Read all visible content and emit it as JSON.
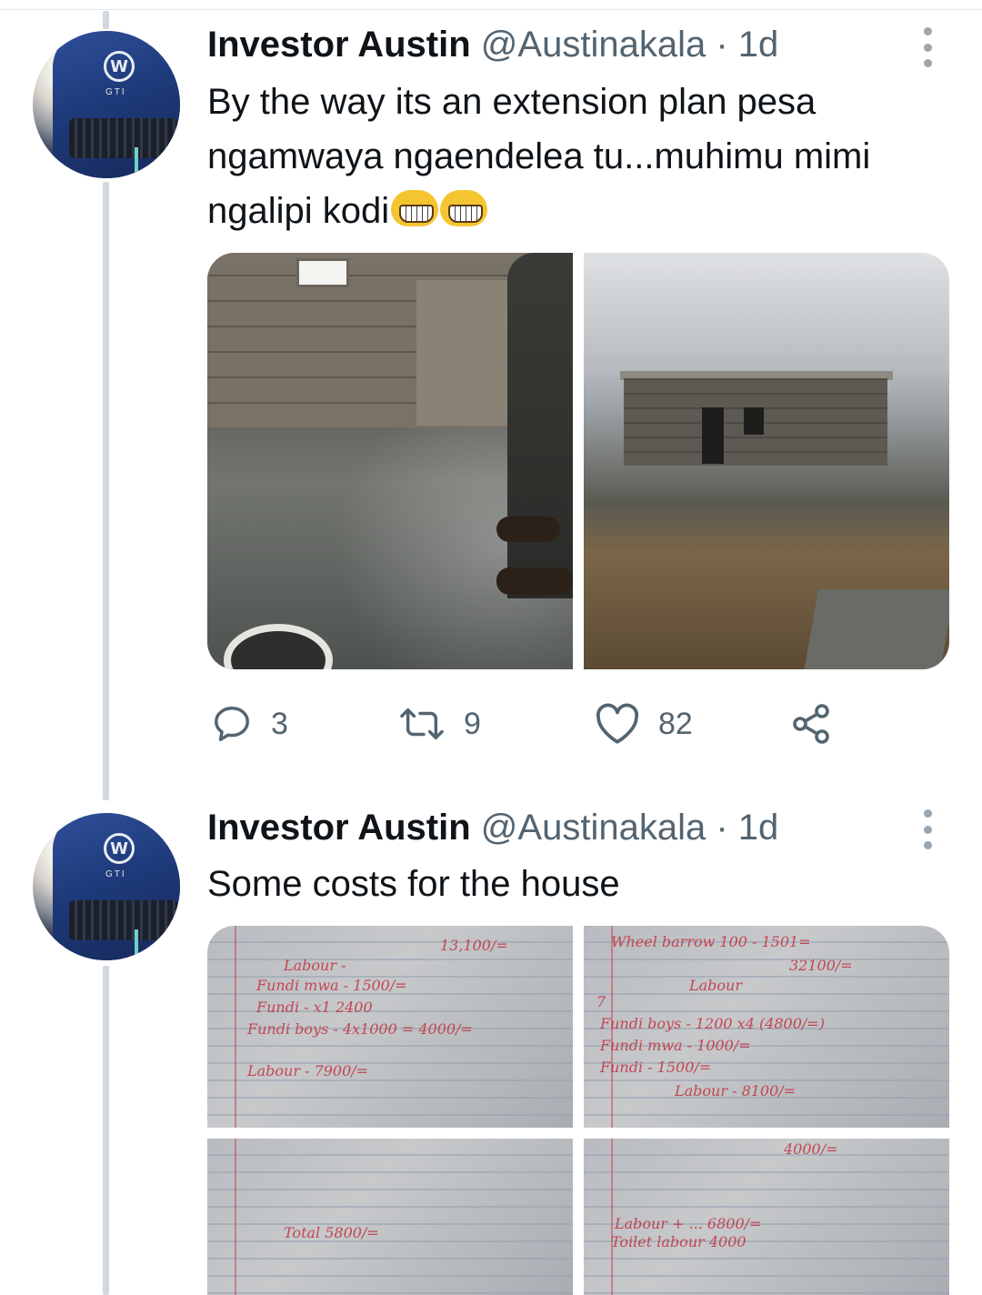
{
  "tweets": [
    {
      "name": "Investor Austin",
      "handle": "@Austinakala",
      "time": "· 1d",
      "text": "By the way its an extension plan pesa ngamwaya ngaendelea tu...muhimu mimi ngalipi kodi",
      "emojis": [
        "grinning-squinting-face",
        "grinning-squinting-face"
      ],
      "actions": {
        "replies": "3",
        "retweets": "9",
        "likes": "82"
      }
    },
    {
      "name": "Investor Austin",
      "handle": "@Austinakala",
      "time": "· 1d",
      "text": "Some costs for the house"
    }
  ],
  "avatar": {
    "badge": "W",
    "label": "GTI"
  },
  "paper_notes": {
    "p1": [
      "13,100/=",
      "Labour - ",
      "Fundi mwa - 1500/=",
      "Fundi - x1 2400",
      "Fundi boys - 4x1000 = 4000/=",
      "Labour - 7900/="
    ],
    "p2": [
      "Wheel barrow 100 - 1501=",
      "32100/=",
      "Labour",
      "7",
      "Fundi boys - 1200 x4 (4800/=)",
      "Fundi mwa - 1000/=",
      "Fundi - 1500/=",
      "Labour - 8100/="
    ],
    "p3": [
      "Total 5800/="
    ],
    "p4": [
      "4000/=",
      "Labour + ... 6800/=",
      "Toilet labour 4000"
    ]
  },
  "colors": {
    "accent": "#1d9bf0",
    "muted": "#536471",
    "thread": "#cfd9de"
  }
}
